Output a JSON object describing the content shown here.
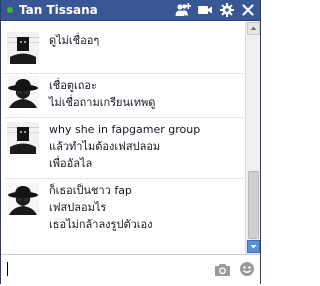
{
  "header": {
    "name": "Tan Tissana",
    "icons": [
      "add-friend-icon",
      "video-call-icon",
      "settings-gear-icon",
      "close-icon"
    ]
  },
  "messages": [
    {
      "sender": "other",
      "avatar": "anonymous-avatar",
      "lines": [
        "ดูไม่เชื่ออๆ"
      ]
    },
    {
      "sender": "me",
      "avatar": "spy-hat-avatar",
      "lines": [
        "เชื่อตูเถอะ",
        "ไม่เชื่อถามเกรียนเทพดู"
      ]
    },
    {
      "sender": "other",
      "avatar": "anonymous-avatar",
      "lines": [
        "why she in fapgamer group",
        "แล้วทำไมต้องเฟสปลอม",
        "เพื่ออัลไล"
      ]
    },
    {
      "sender": "me",
      "avatar": "spy-hat-avatar",
      "lines": [
        "ก็เธอเป็นชาว fap",
        "เฟสปลอมไร",
        "เธอไม่กล้าลงรูปตัวเอง"
      ]
    }
  ],
  "composer": {
    "value": "",
    "placeholder": "",
    "icons": [
      "camera-icon",
      "sticker-icon"
    ]
  },
  "colors": {
    "header_bg": "#3a5795",
    "online_dot": "#42b72a",
    "text": "#141823"
  }
}
